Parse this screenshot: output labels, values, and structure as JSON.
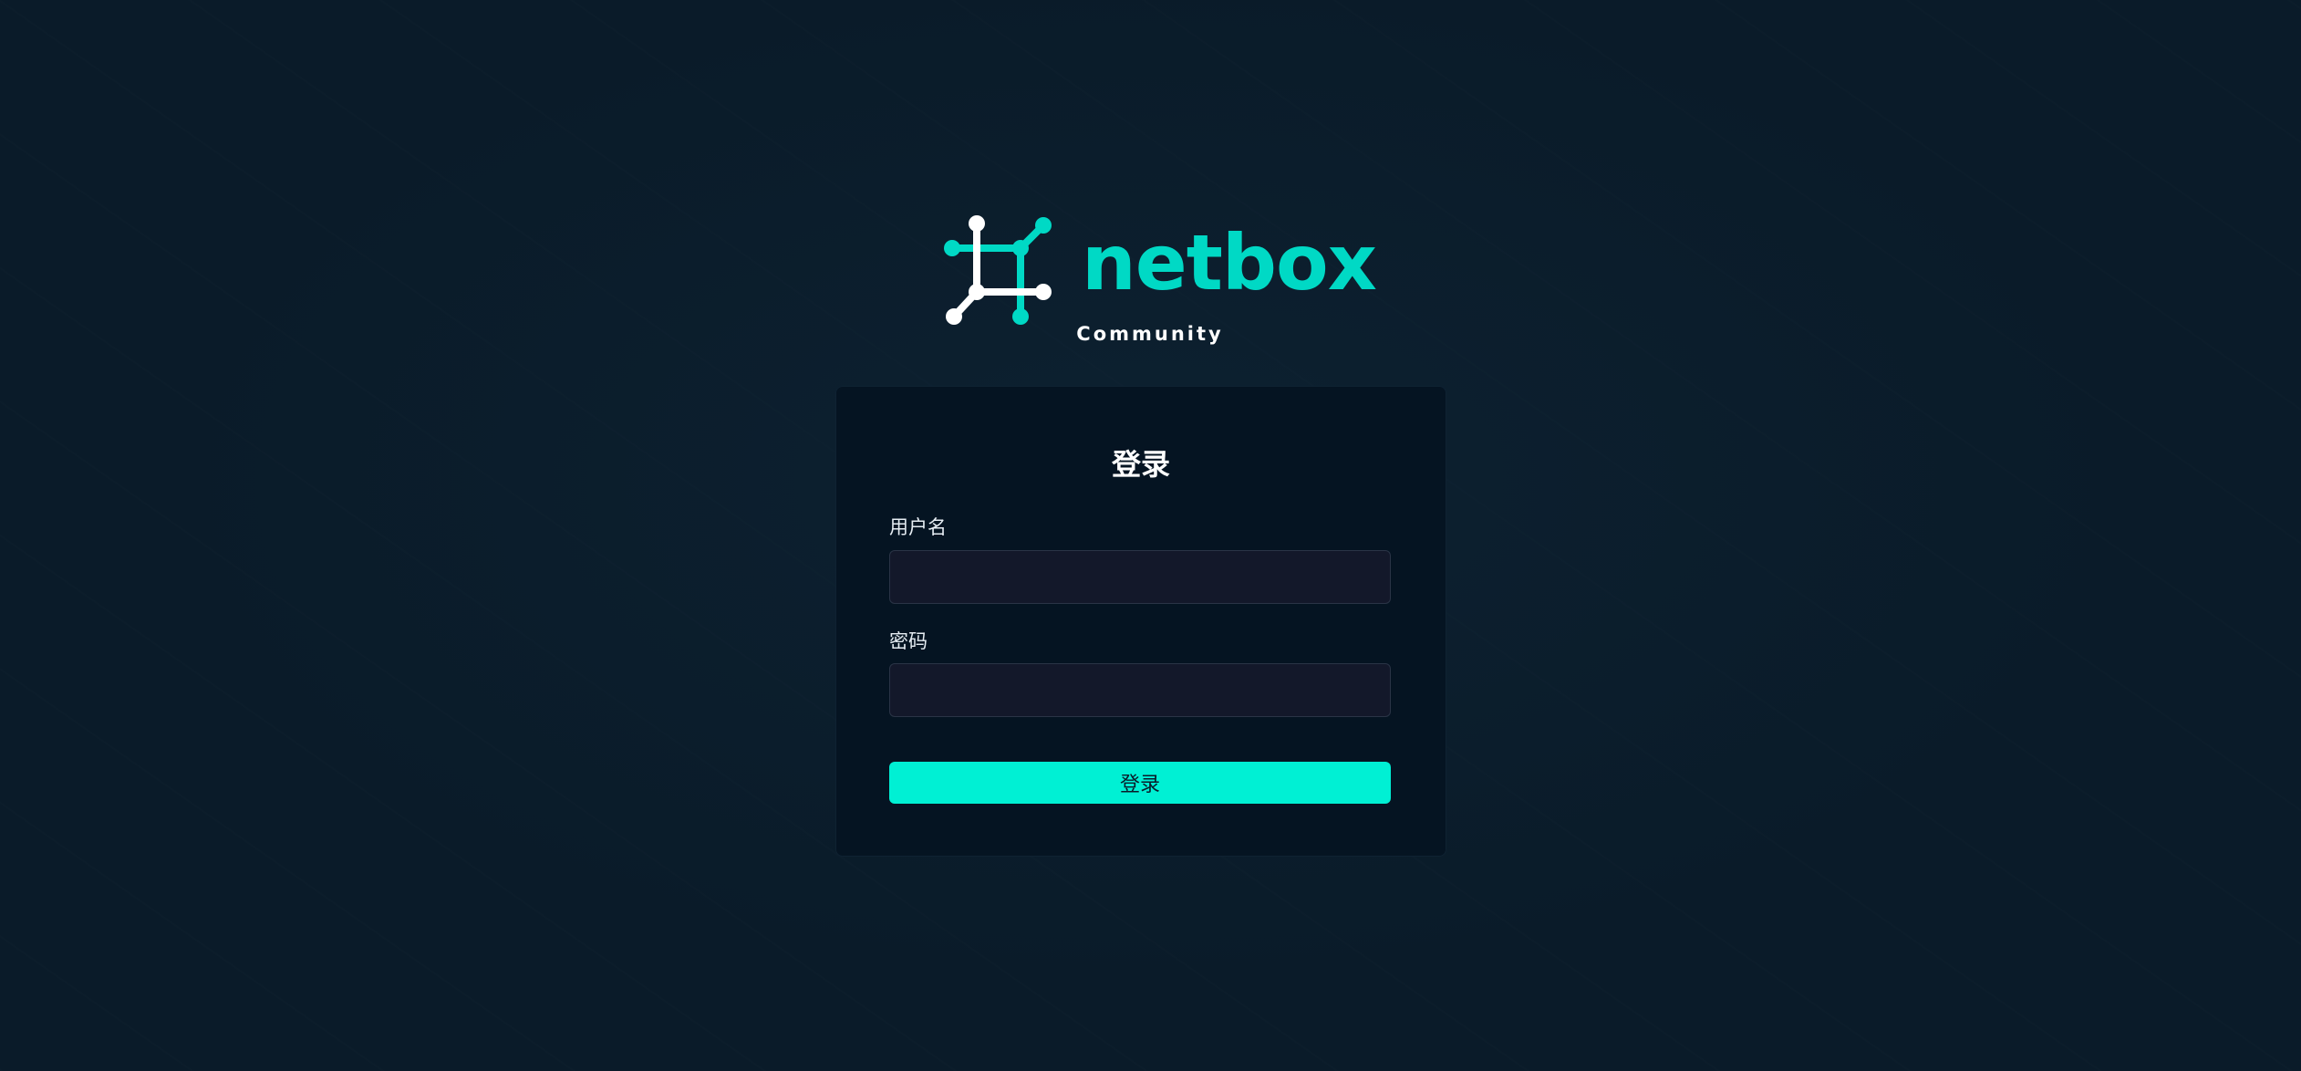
{
  "brand": {
    "wordmark": "netbox",
    "edition": "Community",
    "logo_icon": "netbox-logo-icon",
    "colors": {
      "accent": "#00d9c5",
      "logo_white": "#ffffff"
    }
  },
  "login": {
    "title": "登录",
    "username_label": "用户名",
    "username_value": "",
    "password_label": "密码",
    "password_value": "",
    "submit_label": "登录"
  },
  "colors": {
    "background": "#0a1b29",
    "card": "#051422",
    "input": "#13182a",
    "button": "#00f0d4"
  }
}
